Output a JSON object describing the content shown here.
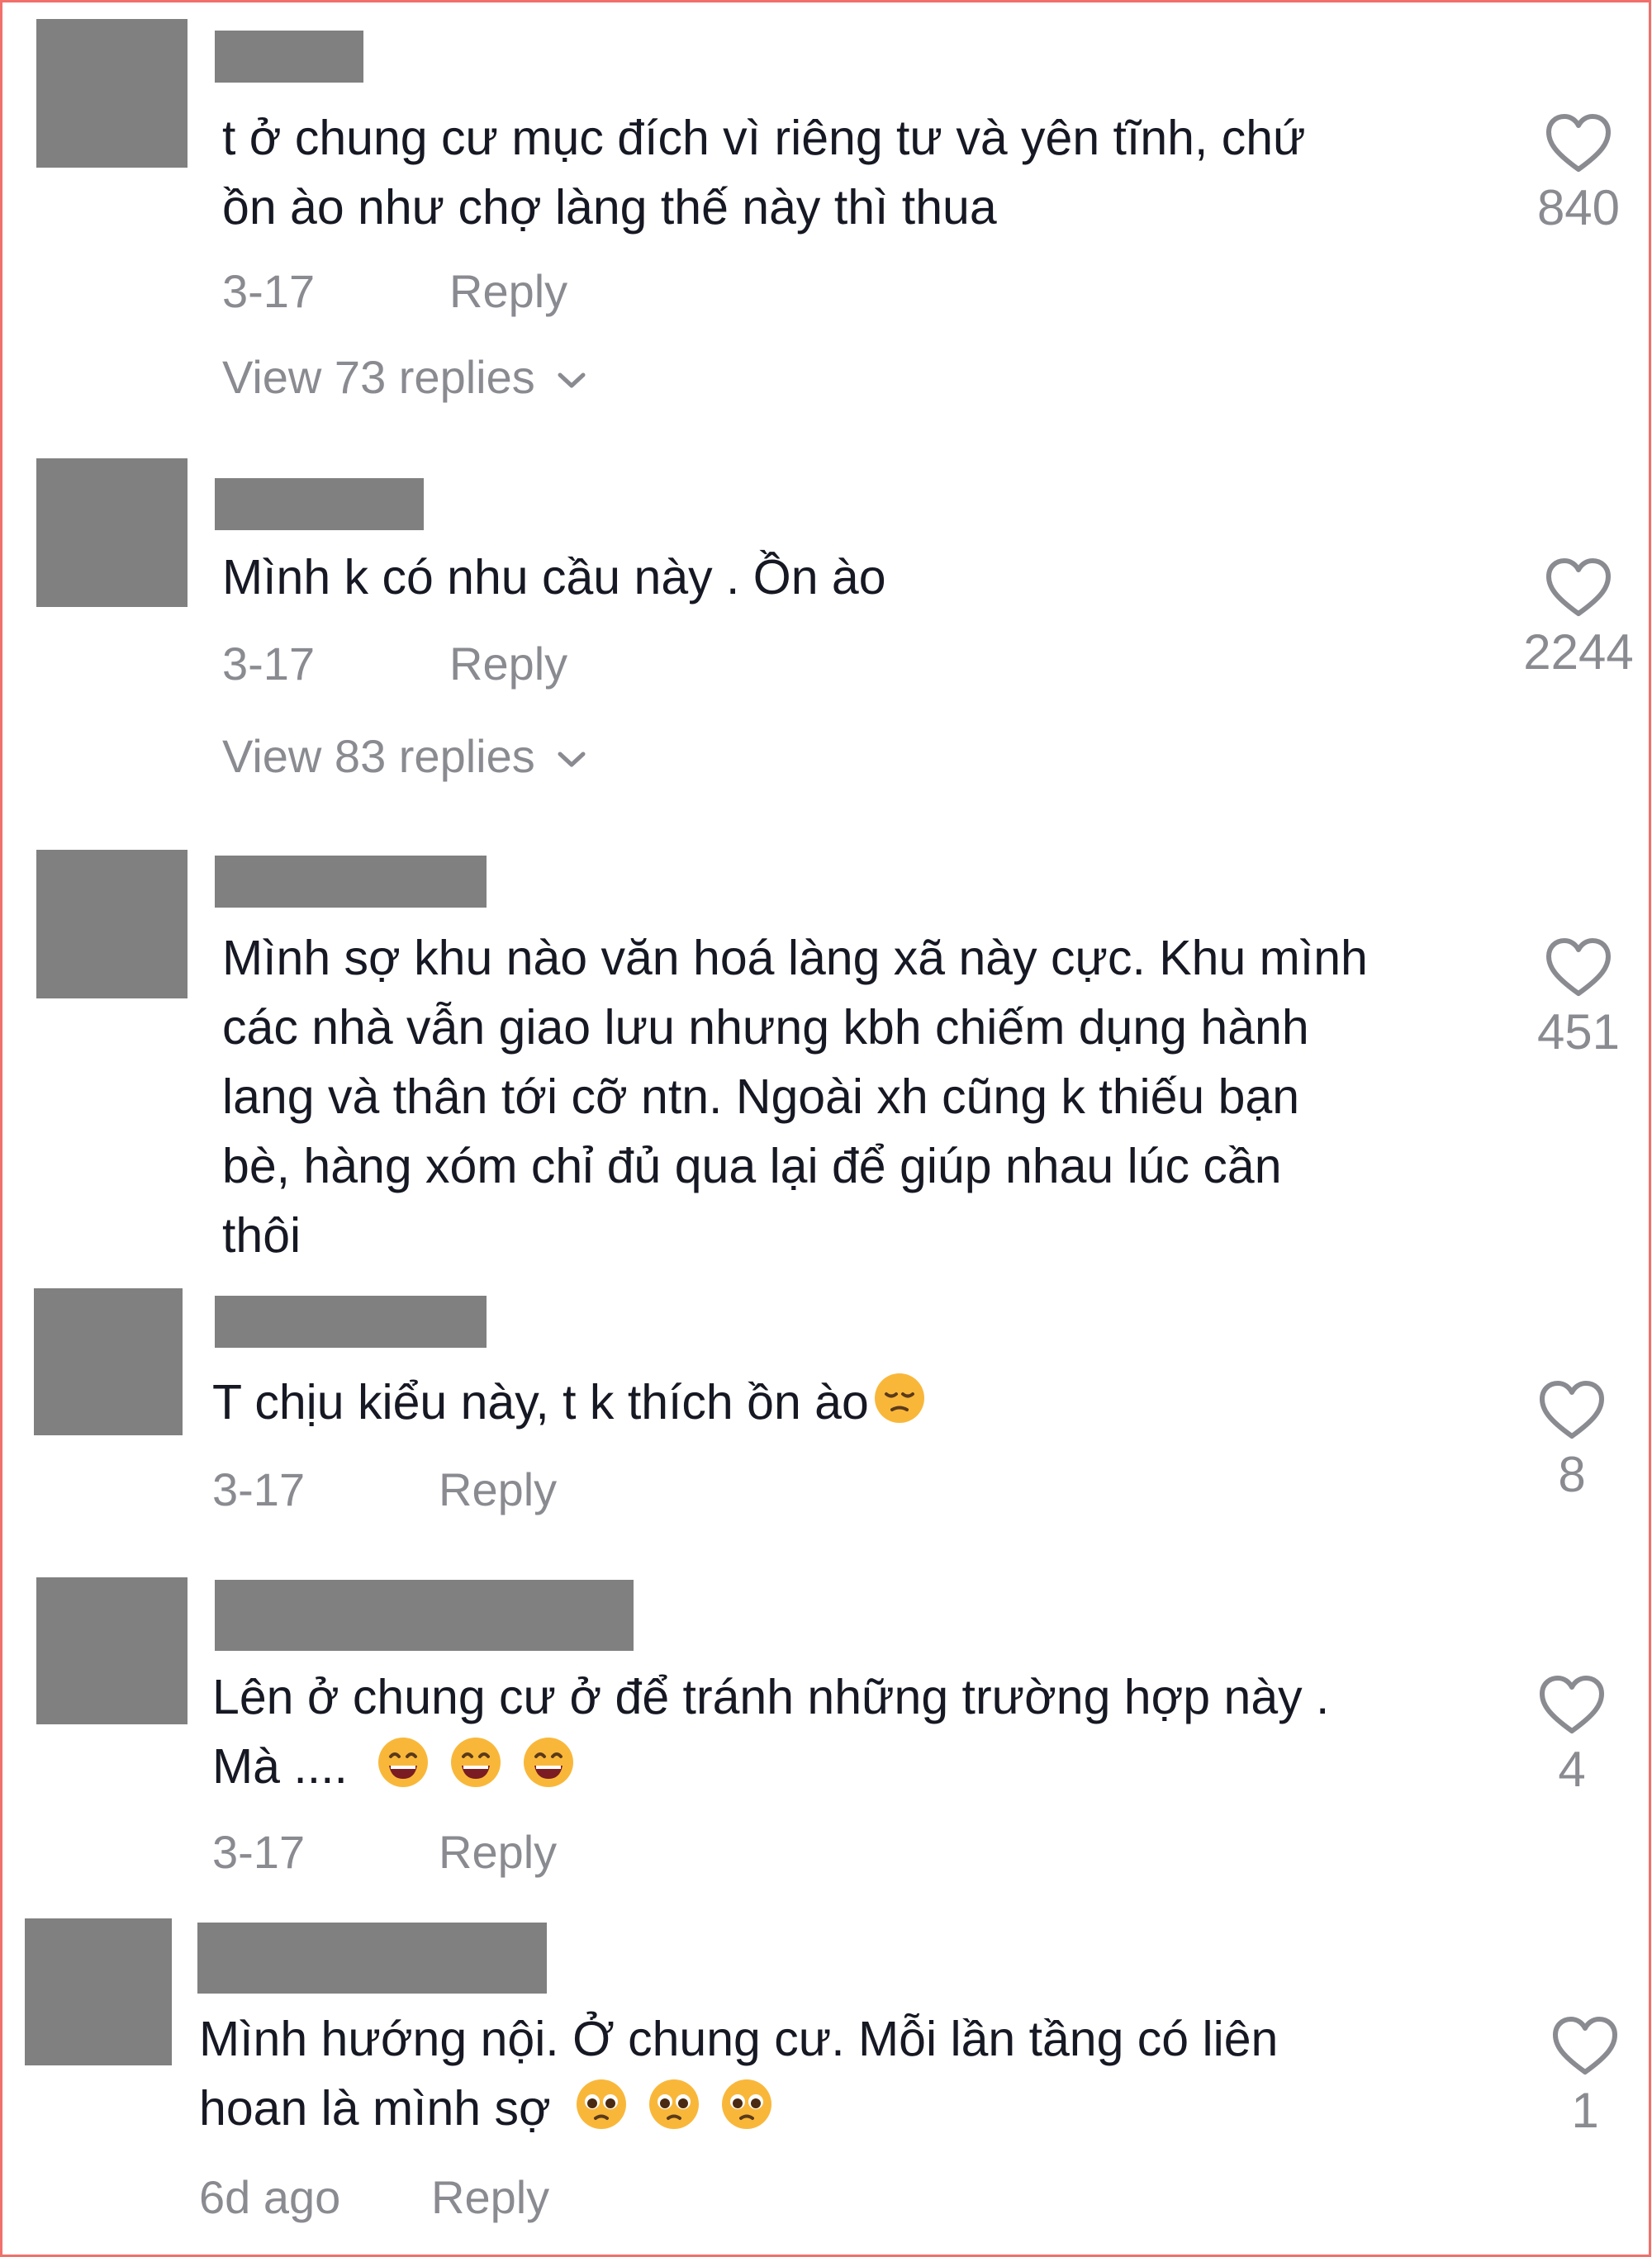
{
  "comments": [
    {
      "lines": [
        "t ở chung cư mục đích vì riêng tư và yên tĩnh, chứ",
        "ồn ào như chợ làng thế này thì thua"
      ],
      "date": "3-17",
      "reply_label": "Reply",
      "view_replies": "View 73 replies",
      "likes": "840"
    },
    {
      "lines": [
        "Mình k có nhu cầu này . Ồn ào"
      ],
      "date": "3-17",
      "reply_label": "Reply",
      "view_replies": "View 83 replies",
      "likes": "2244"
    },
    {
      "lines": [
        "Mình sợ khu nào văn hoá làng xã này cực. Khu mình",
        "các nhà vẫn giao lưu nhưng kbh chiếm dụng hành",
        "lang và thân tới cỡ ntn. Ngoài xh cũng k thiếu bạn",
        "bè, hàng xóm chỉ đủ qua lại để giúp nhau lúc cần",
        "thôi"
      ],
      "likes": "451"
    },
    {
      "lines": [
        "T chịu kiểu này, t k thích ồn ào"
      ],
      "emoji": [
        "pensive-face-emoji"
      ],
      "date": "3-17",
      "reply_label": "Reply",
      "likes": "8"
    },
    {
      "lines": [
        "Lên ở chung cư ở để tránh những trường hợp này .",
        "Mà ...."
      ],
      "emoji": [
        "grinning-face-emoji",
        "grinning-face-emoji",
        "grinning-face-emoji"
      ],
      "date": "3-17",
      "reply_label": "Reply",
      "likes": "4"
    },
    {
      "lines": [
        "Mình hướng nội. Ở chung cư. Mỗi lần tầng có liên",
        "hoan là mình sợ"
      ],
      "emoji": [
        "pleading-face-emoji",
        "pleading-face-emoji",
        "pleading-face-emoji"
      ],
      "date": "6d ago",
      "reply_label": "Reply",
      "likes": "1"
    }
  ],
  "colors": {
    "border": "#f0706b",
    "text": "#161823",
    "meta": "#8a8b91",
    "redaction": "#808080",
    "emoji_yellow": "#f9b73a"
  },
  "icons": {
    "like": "heart-outline-icon",
    "expand": "chevron-down-icon"
  }
}
